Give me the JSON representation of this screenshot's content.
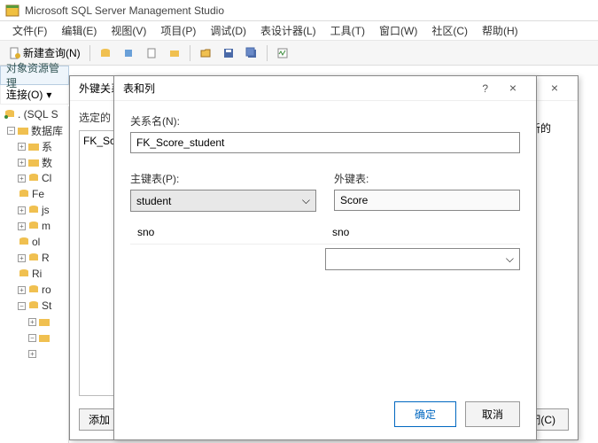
{
  "app": {
    "title": "Microsoft SQL Server Management Studio"
  },
  "menu": {
    "file": "文件(F)",
    "edit": "编辑(E)",
    "view": "视图(V)",
    "project": "项目(P)",
    "debug": "调试(D)",
    "designer": "表设计器(L)",
    "tools": "工具(T)",
    "window": "窗口(W)",
    "community": "社区(C)",
    "help": "帮助(H)"
  },
  "toolbar": {
    "newquery": "新建查询(N)"
  },
  "explorer": {
    "header": "对象资源管理",
    "connect": "连接(O)"
  },
  "tree": {
    "root": ". (SQL S",
    "db": "数据库",
    "items": [
      "系",
      "数",
      "Cl",
      "Fe",
      "js",
      "m",
      "ol",
      "R",
      "Ri",
      "ro",
      "St"
    ]
  },
  "dlg_back": {
    "title": "外键关系",
    "selected_label": "选定的 关",
    "item": "FK_Sco",
    "add": "添加",
    "right_label": "接受新的",
    "close": "关闭(C)"
  },
  "dlg_front": {
    "title": "表和列",
    "name_label": "关系名(N):",
    "name_value": "FK_Score_student",
    "pk_label": "主键表(P):",
    "pk_value": "student",
    "fk_label": "外键表:",
    "fk_value": "Score",
    "pk_col": "sno",
    "fk_col": "sno",
    "ok": "确定",
    "cancel": "取消"
  }
}
